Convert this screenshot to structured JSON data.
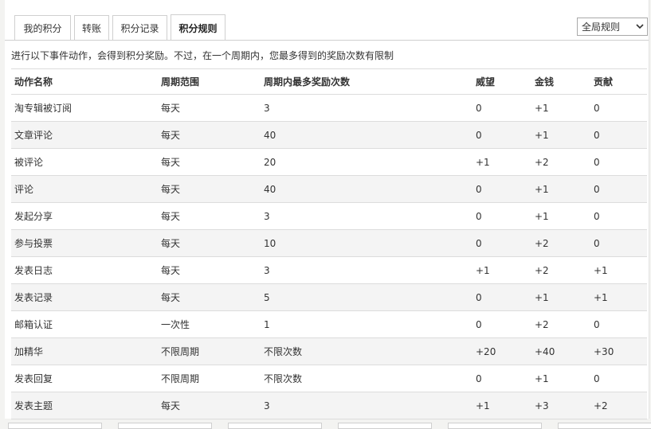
{
  "tabs": [
    {
      "label": "我的积分"
    },
    {
      "label": "转账"
    },
    {
      "label": "积分记录"
    },
    {
      "label": "积分规则",
      "active": true
    }
  ],
  "scope_select": {
    "selected": "全局规则"
  },
  "intro_text": "进行以下事件动作，会得到积分奖励。不过，在一个周期内，您最多得到的奖励次数有限制",
  "table": {
    "headers": [
      "动作名称",
      "周期范围",
      "周期内最多奖励次数",
      "威望",
      "金钱",
      "贡献"
    ],
    "rows": [
      [
        "淘专辑被订阅",
        "每天",
        "3",
        "0",
        "+1",
        "0"
      ],
      [
        "文章评论",
        "每天",
        "40",
        "0",
        "+1",
        "0"
      ],
      [
        "被评论",
        "每天",
        "20",
        "+1",
        "+2",
        "0"
      ],
      [
        "评论",
        "每天",
        "40",
        "0",
        "+1",
        "0"
      ],
      [
        "发起分享",
        "每天",
        "3",
        "0",
        "+1",
        "0"
      ],
      [
        "参与投票",
        "每天",
        "10",
        "0",
        "+2",
        "0"
      ],
      [
        "发表日志",
        "每天",
        "3",
        "+1",
        "+2",
        "+1"
      ],
      [
        "发表记录",
        "每天",
        "5",
        "0",
        "+1",
        "+1"
      ],
      [
        "邮箱认证",
        "一次性",
        "1",
        "0",
        "+2",
        "0"
      ],
      [
        "加精华",
        "不限周期",
        "不限次数",
        "+20",
        "+40",
        "+30"
      ],
      [
        "发表回复",
        "不限周期",
        "不限次数",
        "0",
        "+1",
        "0"
      ],
      [
        "发表主题",
        "每天",
        "3",
        "+1",
        "+3",
        "+2"
      ]
    ]
  },
  "icons": {
    "select_arrow": "chevron-down-icon"
  }
}
